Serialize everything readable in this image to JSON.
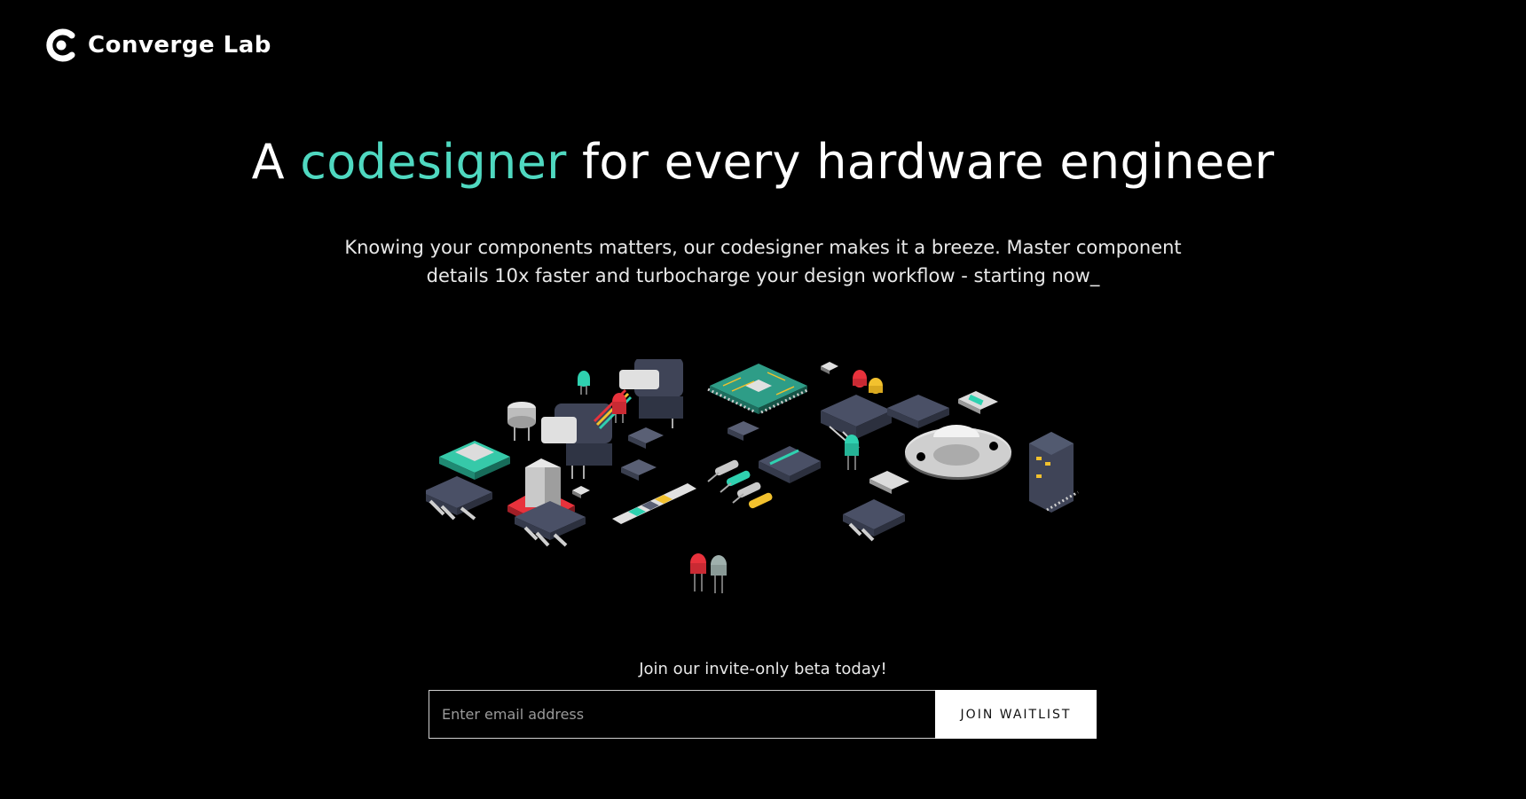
{
  "brand": {
    "name": "Converge Lab",
    "logo_icon": "converge-c-logo-icon"
  },
  "hero": {
    "headline_prefix": "A ",
    "headline_accent": "codesigner",
    "headline_suffix": " for every hardware engineer",
    "subtext_line1": "Knowing your components matters, our codesigner makes it a breeze. Master component",
    "subtext_line2": "details 10x faster and turbocharge your design workflow - starting now_"
  },
  "illustration": {
    "icon": "electronic-components-illustration"
  },
  "waitlist": {
    "label": "Join our invite-only beta today!",
    "email_placeholder": "Enter email address",
    "email_value": "",
    "button_label": "JOIN WAITLIST"
  },
  "colors": {
    "background": "#000000",
    "accent": "#4fd8c0",
    "text": "#ffffff",
    "button_bg": "#ffffff",
    "button_text": "#111111"
  }
}
